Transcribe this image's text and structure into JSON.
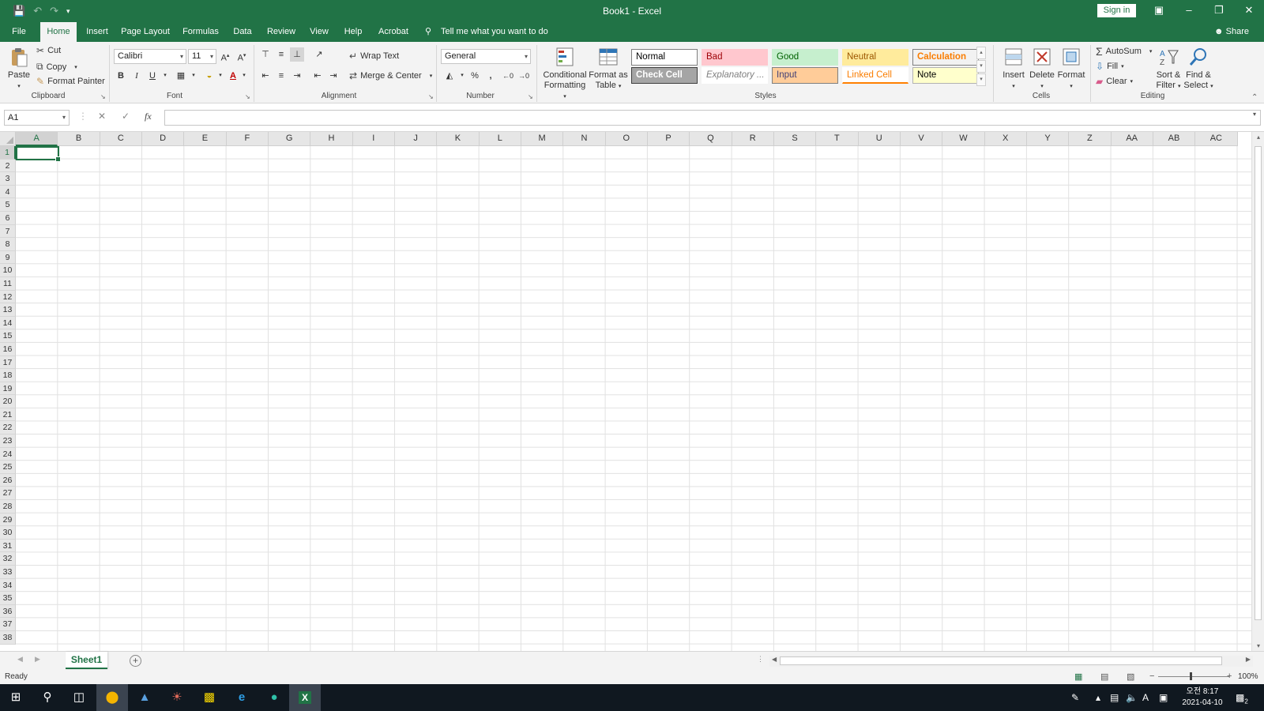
{
  "titlebar": {
    "title": "Book1  -  Excel",
    "sign_in": "Sign in"
  },
  "tabs": [
    {
      "label": "File"
    },
    {
      "label": "Home"
    },
    {
      "label": "Insert"
    },
    {
      "label": "Page Layout"
    },
    {
      "label": "Formulas"
    },
    {
      "label": "Data"
    },
    {
      "label": "Review"
    },
    {
      "label": "View"
    },
    {
      "label": "Help"
    },
    {
      "label": "Acrobat"
    }
  ],
  "tell_me": "Tell me what you want to do",
  "share": "Share",
  "clipboard": {
    "paste": "Paste",
    "cut": "Cut",
    "copy": "Copy",
    "format_painter": "Format Painter",
    "label": "Clipboard"
  },
  "font": {
    "name": "Calibri",
    "size": "11",
    "label": "Font",
    "bold": "B",
    "italic": "I",
    "underline": "U"
  },
  "alignment": {
    "wrap_text": "Wrap Text",
    "merge_center": "Merge & Center",
    "label": "Alignment"
  },
  "number": {
    "format": "General",
    "label": "Number",
    "percent": "%",
    "comma": ","
  },
  "styles": {
    "conditional_formatting": "Conditional Formatting",
    "format_as_table": "Format as Table",
    "label": "Styles",
    "cells": [
      {
        "label": "Normal",
        "bg": "#ffffff",
        "fg": "#000000",
        "border": "#7f7f7f"
      },
      {
        "label": "Bad",
        "bg": "#ffc7ce",
        "fg": "#9c0006",
        "border": "transparent"
      },
      {
        "label": "Good",
        "bg": "#c6efce",
        "fg": "#006100",
        "border": "transparent"
      },
      {
        "label": "Neutral",
        "bg": "#ffeb9c",
        "fg": "#9c5700",
        "border": "transparent"
      },
      {
        "label": "Calculation",
        "bg": "#f2f2f2",
        "fg": "#fa7d00",
        "border": "#7f7f7f"
      },
      {
        "label": "Check Cell",
        "bg": "#a5a5a5",
        "fg": "#ffffff",
        "border": "#3f3f3f"
      },
      {
        "label": "Explanatory ...",
        "bg": "#ffffff",
        "fg": "#7f7f7f",
        "border": "transparent"
      },
      {
        "label": "Input",
        "bg": "#ffcc99",
        "fg": "#3f3f76",
        "border": "#7f7f7f"
      },
      {
        "label": "Linked Cell",
        "bg": "#ffffff",
        "fg": "#fa7d00",
        "border": "transparent"
      },
      {
        "label": "Note",
        "bg": "#ffffcc",
        "fg": "#000000",
        "border": "#b2b2b2"
      }
    ]
  },
  "cells_group": {
    "insert": "Insert",
    "delete": "Delete",
    "format": "Format",
    "label": "Cells"
  },
  "editing": {
    "autosum": "AutoSum",
    "fill": "Fill",
    "clear": "Clear",
    "sort_filter": "Sort & Filter",
    "find_select": "Find & Select",
    "label": "Editing"
  },
  "formula_bar": {
    "name_box": "A1",
    "fx": "fx",
    "value": ""
  },
  "grid": {
    "columns": [
      "A",
      "B",
      "C",
      "D",
      "E",
      "F",
      "G",
      "H",
      "I",
      "J",
      "K",
      "L",
      "M",
      "N",
      "O",
      "P",
      "Q",
      "R",
      "S",
      "T",
      "U",
      "V",
      "W",
      "X",
      "Y",
      "Z",
      "AA",
      "AB",
      "AC"
    ],
    "rows": [
      "1",
      "2",
      "3",
      "4",
      "5",
      "6",
      "7",
      "8",
      "9",
      "10",
      "11",
      "12",
      "13",
      "14",
      "15",
      "16",
      "17",
      "18",
      "19",
      "20",
      "21",
      "22",
      "23",
      "24",
      "25",
      "26",
      "27",
      "28",
      "29",
      "30",
      "31",
      "32",
      "33",
      "34",
      "35",
      "36",
      "37",
      "38"
    ],
    "active_cell": "A1"
  },
  "sheets": [
    {
      "label": "Sheet1"
    }
  ],
  "status": {
    "ready": "Ready",
    "zoom": "100%"
  },
  "taskbar": {
    "time": "오전 8:17",
    "date": "2021-04-10",
    "notifications": "2"
  },
  "colors": {
    "accent": "#217346"
  }
}
